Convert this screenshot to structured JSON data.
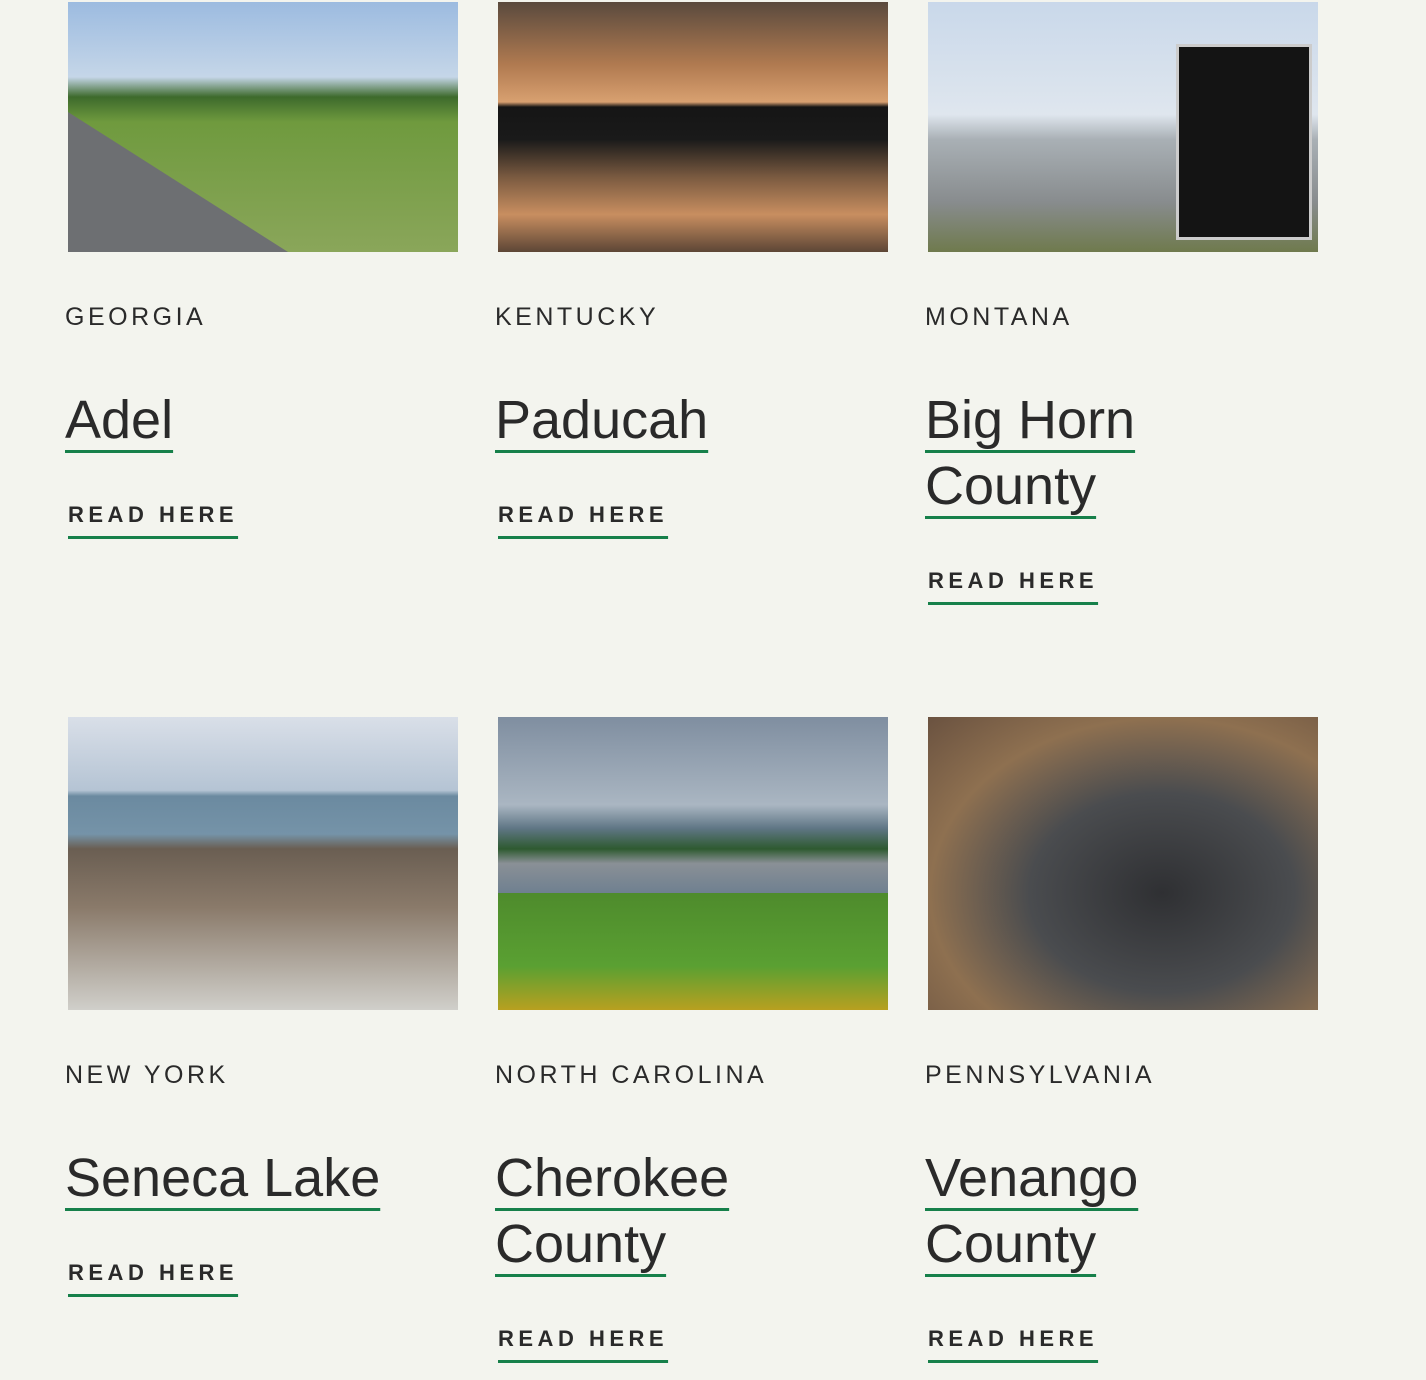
{
  "cards": [
    {
      "state": "GEORGIA",
      "title": "Adel",
      "link": "READ HERE",
      "image": "rural road with Adel city limit sign"
    },
    {
      "state": "KENTUCKY",
      "title": "Paducah",
      "link": "READ HERE",
      "image": "power plant smokestacks over water at sunset"
    },
    {
      "state": "MONTANA",
      "title": "Big Horn County",
      "link": "READ HERE",
      "image": "Big Horn Data Hub sign at industrial facility"
    },
    {
      "state": "NEW YORK",
      "title": "Seneca Lake",
      "link": "READ HERE",
      "image": "aerial view of power plant by lake"
    },
    {
      "state": "NORTH CAROLINA",
      "title": "Cherokee County",
      "link": "READ HERE",
      "image": "shipping containers behind green field"
    },
    {
      "state": "PENNSYLVANIA",
      "title": "Venango County",
      "link": "READ HERE",
      "image": "aerial view of coal waste site"
    }
  ],
  "colors": {
    "background": "#f3f4ee",
    "accent": "#16804a",
    "text": "#2a2a2a"
  }
}
